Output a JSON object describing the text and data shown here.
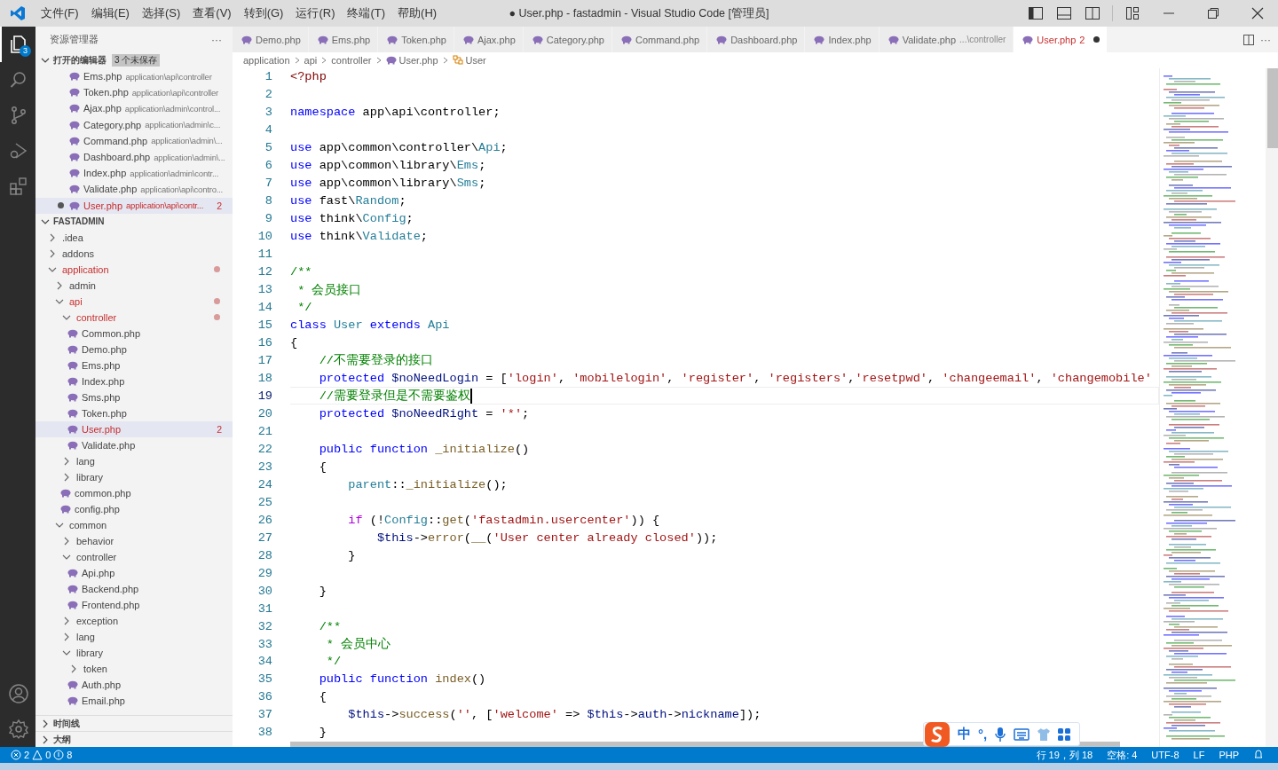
{
  "window": {
    "title": "● User.php - fastadmin - Visual Studio Code [管理员]"
  },
  "menu": [
    "文件(F)",
    "编辑(E)",
    "选择(S)",
    "查看(V)",
    "转到(G)",
    "运行(R)",
    "终端(T)",
    "帮助(H)"
  ],
  "activity_bar": {
    "explorer_badge": "3"
  },
  "sidebar": {
    "title": "资源管理器",
    "more": "···",
    "open_editors": {
      "title": "打开的编辑器",
      "badge": "3 个未保存",
      "items": [
        {
          "name": "Ems.php",
          "path": "application\\api\\controller",
          "selected": false,
          "modified": false
        },
        {
          "name": "Token.php",
          "path": "application\\api\\controller",
          "selected": false,
          "modified": false
        },
        {
          "name": "Ajax.php",
          "path": "application\\admin\\control...",
          "selected": false,
          "modified": false
        },
        {
          "name": "Category.php",
          "path": "application\\admin\\c...",
          "selected": false,
          "modified": false
        },
        {
          "name": "Command.php",
          "path": "application\\admin\\...",
          "selected": false,
          "modified": false
        },
        {
          "name": "Dashboard.php",
          "path": "application\\admin\\...",
          "selected": false,
          "modified": false
        },
        {
          "name": "Index.php",
          "path": "application\\admin\\contr...",
          "selected": false,
          "modified": false
        },
        {
          "name": "Validate.php",
          "path": "application\\api\\contro...",
          "selected": false,
          "modified": false
        },
        {
          "name": "User.php",
          "path": "application\\api\\contr...",
          "badge": "2",
          "selected": true,
          "modified": true
        }
      ]
    },
    "folder": {
      "title": "FASTADMIN",
      "tree": [
        {
          "name": ".idea",
          "kind": "folder",
          "expanded": false
        },
        {
          "name": "addons",
          "kind": "folder",
          "expanded": false
        },
        {
          "name": "application",
          "kind": "folder",
          "expanded": true,
          "modified": true,
          "children": [
            {
              "name": "admin",
              "kind": "folder",
              "expanded": false
            },
            {
              "name": "api",
              "kind": "folder",
              "expanded": true,
              "modified": true,
              "children": [
                {
                  "name": "controller",
                  "kind": "folder",
                  "expanded": true,
                  "modified": true,
                  "children": [
                    {
                      "name": "Common.php",
                      "kind": "file"
                    },
                    {
                      "name": "Demo.php",
                      "kind": "file"
                    },
                    {
                      "name": "Ems.php",
                      "kind": "file"
                    },
                    {
                      "name": "Index.php",
                      "kind": "file"
                    },
                    {
                      "name": "Sms.php",
                      "kind": "file"
                    },
                    {
                      "name": "Token.php",
                      "kind": "file"
                    },
                    {
                      "name": "User.php",
                      "kind": "file",
                      "selected": true,
                      "modified": true,
                      "badge": "2"
                    },
                    {
                      "name": "Validate.php",
                      "kind": "file"
                    }
                  ]
                },
                {
                  "name": "lang",
                  "kind": "folder",
                  "expanded": false
                },
                {
                  "name": "library",
                  "kind": "folder",
                  "expanded": false
                },
                {
                  "name": "common.php",
                  "kind": "file"
                },
                {
                  "name": "config.php",
                  "kind": "file"
                }
              ]
            },
            {
              "name": "common",
              "kind": "folder",
              "expanded": true,
              "children": [
                {
                  "name": "behavior",
                  "kind": "folder",
                  "expanded": false
                },
                {
                  "name": "controller",
                  "kind": "folder",
                  "expanded": true,
                  "children": [
                    {
                      "name": "Api.php",
                      "kind": "file"
                    },
                    {
                      "name": "Backend.php",
                      "kind": "file"
                    },
                    {
                      "name": "Frontend.php",
                      "kind": "file"
                    }
                  ]
                },
                {
                  "name": "exception",
                  "kind": "folder",
                  "expanded": false
                },
                {
                  "name": "lang",
                  "kind": "folder",
                  "expanded": false
                },
                {
                  "name": "library",
                  "kind": "folder",
                  "expanded": true,
                  "children": [
                    {
                      "name": "token",
                      "kind": "folder",
                      "expanded": false
                    },
                    {
                      "name": "Auth.php",
                      "kind": "file"
                    },
                    {
                      "name": "Email.php",
                      "kind": "file"
                    }
                  ]
                }
              ]
            }
          ]
        }
      ]
    },
    "sections": [
      "时间线",
      "大纲"
    ]
  },
  "tabs": [
    {
      "name": "Demo.php",
      "selected": false,
      "modified": false
    },
    {
      "name": "Ems.php",
      "selected": false,
      "modified": false
    },
    {
      "name": "Token.php",
      "selected": false,
      "modified": false
    },
    {
      "name": "Ajax.php",
      "selected": false,
      "modified": false
    },
    {
      "name": "Category.php",
      "selected": false,
      "modified": false
    },
    {
      "name": "Command.php",
      "selected": false,
      "modified": false
    },
    {
      "name": "Dashboard.php",
      "selected": false,
      "modified": false
    },
    {
      "name": "Index.php",
      "selected": false,
      "modified": false
    },
    {
      "name": "Validate.php",
      "description": "...\\controller",
      "selected": false,
      "modified": false
    },
    {
      "name": "User.php",
      "badge": "2",
      "selected": true,
      "modified": true
    }
  ],
  "breadcrumbs": [
    {
      "text": "application",
      "kind": "folder"
    },
    {
      "text": "api",
      "kind": "folder"
    },
    {
      "text": "controller",
      "kind": "folder"
    },
    {
      "text": "User.php",
      "kind": "file"
    },
    {
      "text": "User",
      "kind": "class"
    }
  ],
  "code": [
    {
      "number": "1",
      "tokens": [
        {
          "kind": "tag",
          "text": "<?php"
        }
      ]
    },
    {
      "number": "2"
    },
    {
      "number": "3",
      "tokens": [
        {
          "kind": "kw",
          "text": "namespace"
        },
        {
          "kind": "plain",
          "text": " app\\api\\controller;"
        }
      ]
    },
    {
      "number": "4"
    },
    {
      "number": "5",
      "tokens": [
        {
          "kind": "kw",
          "text": "use"
        },
        {
          "kind": "plain",
          "text": " app\\common\\controller\\"
        },
        {
          "kind": "cls",
          "text": "Api"
        },
        {
          "kind": "plain",
          "text": ";"
        }
      ]
    },
    {
      "number": "6",
      "tokens": [
        {
          "kind": "kw",
          "text": "use"
        },
        {
          "kind": "plain",
          "text": " app\\common\\library\\"
        },
        {
          "kind": "cls",
          "text": "Ems"
        },
        {
          "kind": "plain",
          "text": ";"
        }
      ]
    },
    {
      "number": "7",
      "tokens": [
        {
          "kind": "kw",
          "text": "use"
        },
        {
          "kind": "plain",
          "text": " app\\common\\library\\"
        },
        {
          "kind": "cls",
          "text": "Sms"
        },
        {
          "kind": "plain",
          "text": ";"
        }
      ]
    },
    {
      "number": "8",
      "tokens": [
        {
          "kind": "kw",
          "text": "use"
        },
        {
          "kind": "plain",
          "text": " fast\\"
        },
        {
          "kind": "cls",
          "text": "Random"
        },
        {
          "kind": "plain",
          "text": ";"
        }
      ]
    },
    {
      "number": "9",
      "tokens": [
        {
          "kind": "kw",
          "text": "use"
        },
        {
          "kind": "plain",
          "text": " think\\"
        },
        {
          "kind": "cls",
          "text": "Config"
        },
        {
          "kind": "plain",
          "text": ";"
        }
      ]
    },
    {
      "number": "10",
      "tokens": [
        {
          "kind": "kw",
          "text": "use"
        },
        {
          "kind": "plain",
          "text": " think\\"
        },
        {
          "kind": "cls",
          "text": "Validate"
        },
        {
          "kind": "plain",
          "text": ";"
        }
      ]
    },
    {
      "number": "11"
    },
    {
      "number": "12",
      "tokens": [
        {
          "kind": "cm",
          "text": "/**"
        }
      ]
    },
    {
      "number": "13",
      "tokens": [
        {
          "kind": "cm",
          "text": " * 会员接口"
        }
      ]
    },
    {
      "number": "14",
      "tokens": [
        {
          "kind": "cm",
          "text": " */"
        }
      ]
    },
    {
      "number": "15",
      "tokens": [
        {
          "kind": "kw",
          "text": "class "
        },
        {
          "kind": "cls",
          "text": "User"
        },
        {
          "kind": "kw",
          "text": " extends "
        },
        {
          "kind": "cls",
          "text": "Api"
        }
      ]
    },
    {
      "number": "16",
      "tokens": [
        {
          "kind": "plain",
          "text": "{"
        }
      ]
    },
    {
      "number": "17",
      "tokens": [
        {
          "kind": "cm",
          "text": "    //不需要登录的接口"
        }
      ]
    },
    {
      "number": "18",
      "tokens": [
        {
          "kind": "kw",
          "text": "    protected "
        },
        {
          "kind": "var",
          "text": "$noNeedLogin"
        },
        {
          "kind": "plain",
          "text": " = ["
        },
        {
          "kind": "str",
          "text": "'login'"
        },
        {
          "kind": "plain",
          "text": ", "
        },
        {
          "kind": "str",
          "text": "'mobilelogin'"
        },
        {
          "kind": "plain",
          "text": ", "
        },
        {
          "kind": "str",
          "text": "'register'"
        },
        {
          "kind": "plain",
          "text": ", "
        },
        {
          "kind": "str",
          "text": "'registers'"
        },
        {
          "kind": "plain",
          "text": ","
        },
        {
          "kind": "str",
          "text": "'resetpwd'"
        },
        {
          "kind": "plain",
          "text": ", "
        },
        {
          "kind": "str",
          "text": "'changeemail'"
        },
        {
          "kind": "plain",
          "text": ", "
        },
        {
          "kind": "str",
          "text": "'changemobile'"
        }
      ]
    },
    {
      "number": "19",
      "current": true,
      "tokens": [
        {
          "kind": "cm",
          "text": "    //需要登录但是不需要鉴权"
        }
      ]
    },
    {
      "number": "20",
      "tokens": [
        {
          "kind": "kw",
          "text": "    protected "
        },
        {
          "kind": "var",
          "text": "$noNeedRight"
        },
        {
          "kind": "plain",
          "text": " = "
        },
        {
          "kind": "str",
          "text": "'*'"
        },
        {
          "kind": "plain",
          "text": ";"
        }
      ]
    },
    {
      "number": "21"
    },
    {
      "number": "22",
      "tokens": [
        {
          "kind": "kw",
          "text": "    public function "
        },
        {
          "kind": "fn",
          "text": "_initialize"
        },
        {
          "kind": "plain",
          "text": "()"
        }
      ]
    },
    {
      "number": "23",
      "tokens": [
        {
          "kind": "plain",
          "text": "    {"
        }
      ]
    },
    {
      "number": "24",
      "tokens": [
        {
          "kind": "cls",
          "text": "        parent"
        },
        {
          "kind": "plain",
          "text": "::"
        },
        {
          "kind": "fn",
          "text": "_initialize"
        },
        {
          "kind": "plain",
          "text": "();"
        }
      ]
    },
    {
      "number": "25"
    },
    {
      "number": "26",
      "tokens": [
        {
          "kind": "ctl",
          "text": "        if"
        },
        {
          "kind": "plain",
          "text": " (!"
        },
        {
          "kind": "cls",
          "text": "Config"
        },
        {
          "kind": "plain",
          "text": "::"
        },
        {
          "kind": "fn",
          "text": "get"
        },
        {
          "kind": "plain",
          "text": "("
        },
        {
          "kind": "str",
          "text": "'fastadmin.usercenter'"
        },
        {
          "kind": "plain",
          "text": ")) {"
        }
      ]
    },
    {
      "number": "27",
      "tokens": [
        {
          "kind": "var",
          "text": "            $this"
        },
        {
          "kind": "plain",
          "text": "->"
        },
        {
          "kind": "fn",
          "text": "error"
        },
        {
          "kind": "plain",
          "text": "("
        },
        {
          "kind": "fn",
          "text": "__"
        },
        {
          "kind": "plain",
          "text": "("
        },
        {
          "kind": "str",
          "text": "'User center already closed'"
        },
        {
          "kind": "plain",
          "text": "));"
        }
      ]
    },
    {
      "number": "28",
      "tokens": [
        {
          "kind": "plain",
          "text": "        }"
        }
      ]
    },
    {
      "number": "29"
    },
    {
      "number": "30",
      "tokens": [
        {
          "kind": "plain",
          "text": "    }"
        }
      ]
    },
    {
      "number": "31"
    },
    {
      "number": "32",
      "tokens": [
        {
          "kind": "cm",
          "text": "    /**"
        }
      ]
    },
    {
      "number": "33",
      "tokens": [
        {
          "kind": "cm",
          "text": "     * 会员中心"
        }
      ]
    },
    {
      "number": "34",
      "tokens": [
        {
          "kind": "cm",
          "text": "     */"
        }
      ]
    },
    {
      "number": "35",
      "tokens": [
        {
          "kind": "kw",
          "text": "    public function "
        },
        {
          "kind": "fn",
          "text": "index"
        },
        {
          "kind": "plain",
          "text": "()"
        }
      ]
    },
    {
      "number": "36",
      "tokens": [
        {
          "kind": "plain",
          "text": "    {"
        }
      ]
    },
    {
      "number": "37",
      "tokens": [
        {
          "kind": "var",
          "text": "        $this"
        },
        {
          "kind": "plain",
          "text": "->"
        },
        {
          "kind": "fn",
          "text": "success"
        },
        {
          "kind": "plain",
          "text": "("
        },
        {
          "kind": "str",
          "text": "''"
        },
        {
          "kind": "plain",
          "text": ", ["
        },
        {
          "kind": "str",
          "text": "'welcome'"
        },
        {
          "kind": "plain",
          "text": " => "
        },
        {
          "kind": "var",
          "text": "$this"
        },
        {
          "kind": "plain",
          "text": "->"
        },
        {
          "kind": "var",
          "text": "auth"
        },
        {
          "kind": "plain",
          "text": "->"
        },
        {
          "kind": "var",
          "text": "nickname"
        },
        {
          "kind": "plain",
          "text": "]);"
        }
      ]
    },
    {
      "number": "38",
      "tokens": [
        {
          "kind": "plain",
          "text": "    }"
        }
      ]
    }
  ],
  "ime_toolbar": {
    "mode": "中",
    "punctuation": "°,"
  },
  "status_bar": {
    "errors": "2",
    "warnings": "0",
    "infos": "8",
    "items": [
      "行 19，列 18",
      "空格: 4",
      "UTF-8",
      "LF",
      "PHP"
    ]
  }
}
